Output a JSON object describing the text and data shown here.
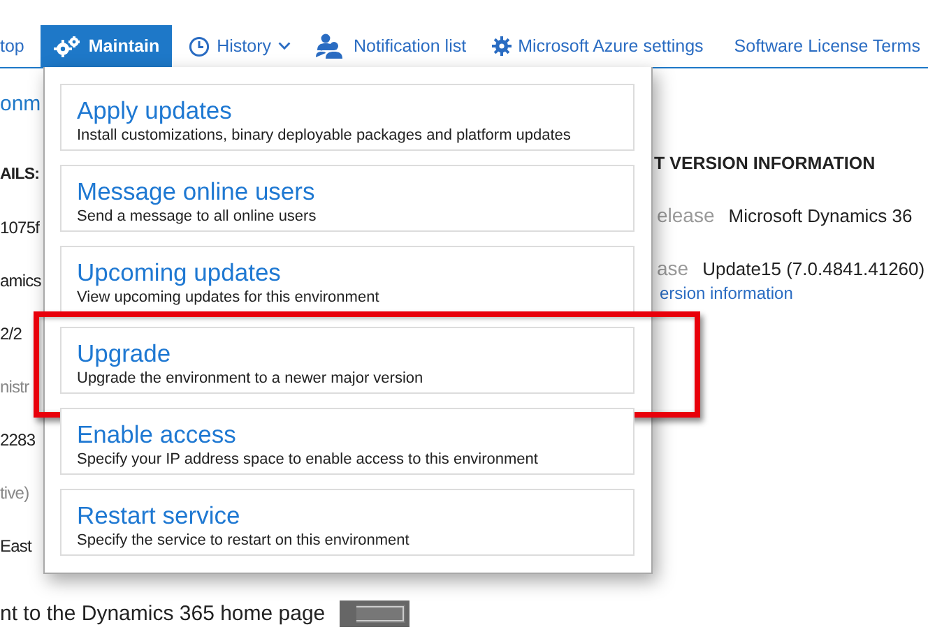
{
  "nav": [
    {
      "label": "top",
      "selected": false
    },
    {
      "label": "Maintain",
      "selected": true
    },
    {
      "label": "History",
      "dropdown": true,
      "selected": false
    },
    {
      "label": "Notification list",
      "selected": false
    },
    {
      "label": "Microsoft Azure settings",
      "selected": false
    },
    {
      "label": "Software License Terms",
      "selected": false
    }
  ],
  "left_column": [
    {
      "kind": "heading",
      "text": "onm"
    },
    {
      "kind": "label",
      "text": "AILS:"
    },
    {
      "kind": "value",
      "text": "1075f"
    },
    {
      "kind": "value",
      "text": "amics"
    },
    {
      "kind": "value",
      "text": "2/2"
    },
    {
      "kind": "muted",
      "text": "nistr"
    },
    {
      "kind": "value",
      "text": "2283"
    },
    {
      "kind": "muted",
      "text": "tive)"
    },
    {
      "kind": "value",
      "text": "East"
    }
  ],
  "version_info": {
    "heading": "T VERSION INFORMATION",
    "rows": [
      {
        "label": "elease",
        "value": "Microsoft Dynamics 36"
      },
      {
        "label": "ase",
        "value": "Update15 (7.0.4841.41260)"
      }
    ],
    "link": "ersion information"
  },
  "home_page": {
    "label": "nt to the Dynamics 365 home page",
    "toggle": {
      "on": false
    }
  },
  "menu": [
    {
      "title": "Apply updates",
      "description": "Install customizations, binary deployable packages and platform updates",
      "highlighted": false
    },
    {
      "title": "Message online users",
      "description": "Send a message to all online users",
      "highlighted": false
    },
    {
      "title": "Upcoming updates",
      "description": "View upcoming updates for this environment",
      "highlighted": false
    },
    {
      "title": "Upgrade",
      "description": "Upgrade the environment to a newer major version",
      "highlighted": true
    },
    {
      "title": "Enable access",
      "description": "Specify your IP address space to enable access to this environment",
      "highlighted": false
    },
    {
      "title": "Restart service",
      "description": "Specify the service to restart on this environment",
      "highlighted": false
    }
  ]
}
